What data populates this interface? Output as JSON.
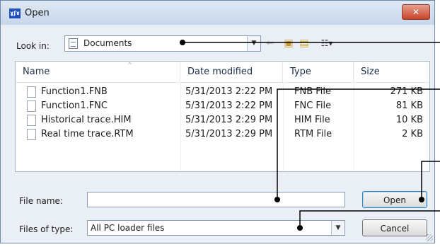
{
  "window": {
    "title": "Open",
    "app_icon_label": "ɣʃɤ",
    "close_symbol": "✕"
  },
  "toolbar": {
    "lookin_label": "Look in:",
    "lookin_value": "Documents",
    "dropdown_glyph": "▼",
    "back_glyph": "⇐",
    "up_glyph": "▣",
    "new_folder_glyph": "▤",
    "view_glyph": "☷▾"
  },
  "list": {
    "columns": [
      "Name",
      "Date modified",
      "Type",
      "Size"
    ],
    "sort_glyph": "^",
    "rows": [
      {
        "name": "Function1.FNB",
        "date": "5/31/2013 2:22 PM",
        "type": "FNB File",
        "size": "271 KB"
      },
      {
        "name": "Function1.FNC",
        "date": "5/31/2013 2:22 PM",
        "type": "FNC File",
        "size": "81 KB"
      },
      {
        "name": "Historical trace.HIM",
        "date": "5/31/2013 2:29 PM",
        "type": "HIM File",
        "size": "10 KB"
      },
      {
        "name": "Real time trace.RTM",
        "date": "5/31/2013 2:29 PM",
        "type": "RTM File",
        "size": "2 KB"
      }
    ]
  },
  "form": {
    "file_name_label": "File name:",
    "file_name_value": "",
    "file_type_label": "Files of type:",
    "file_type_value": "All PC loader files"
  },
  "buttons": {
    "open_label": "Open",
    "cancel_label": "Cancel"
  },
  "colors": {
    "callout": "#000000",
    "close_button": "#c8422a",
    "title_bar": "#c6d6ea"
  }
}
